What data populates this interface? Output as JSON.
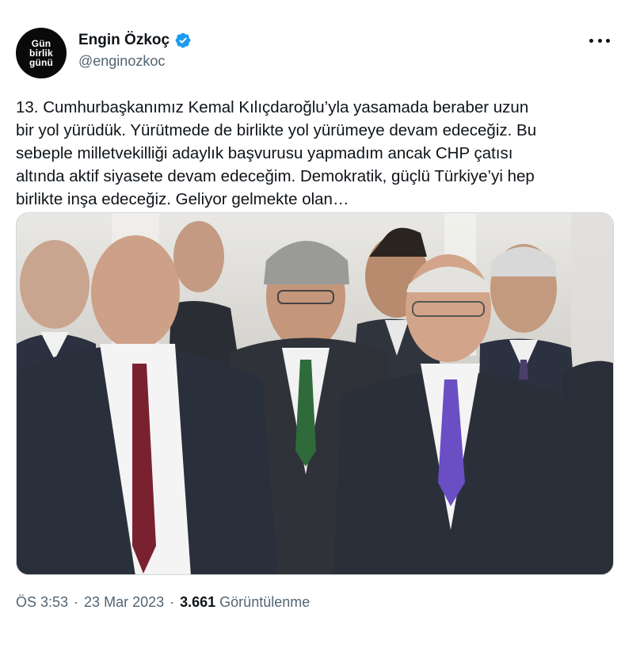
{
  "author": {
    "avatar_text": [
      "Gün",
      "birlik",
      "günü"
    ],
    "display_name": "Engin Özkoç",
    "handle": "@enginozkoc",
    "verified": true,
    "verified_color": "#1d9bf0"
  },
  "tweet": {
    "text": "13. Cumhurbaşkanımız Kemal Kılıçdaroğlu’yla yasamada beraber uzun\nbir yol yürüdük. Yürütmede de birlikte yol yürümeye devam edeceğiz. Bu\nsebeple milletvekilliği adaylık başvurusu yapmadım ancak CHP çatısı\naltında aktif siyasete devam edeceğim. Demokratik, güçlü Türkiye’yi hep\nbirlikte inşa edeceğiz. Geliyor gelmekte olan…"
  },
  "meta": {
    "time": "ÖS 3:53",
    "date": "23 Mar 2023",
    "separator": "·",
    "views_count": "3.661",
    "views_label": "Görüntülenme"
  },
  "icons": {
    "more": "more-horizontal-icon",
    "verified": "verified-badge-icon"
  }
}
